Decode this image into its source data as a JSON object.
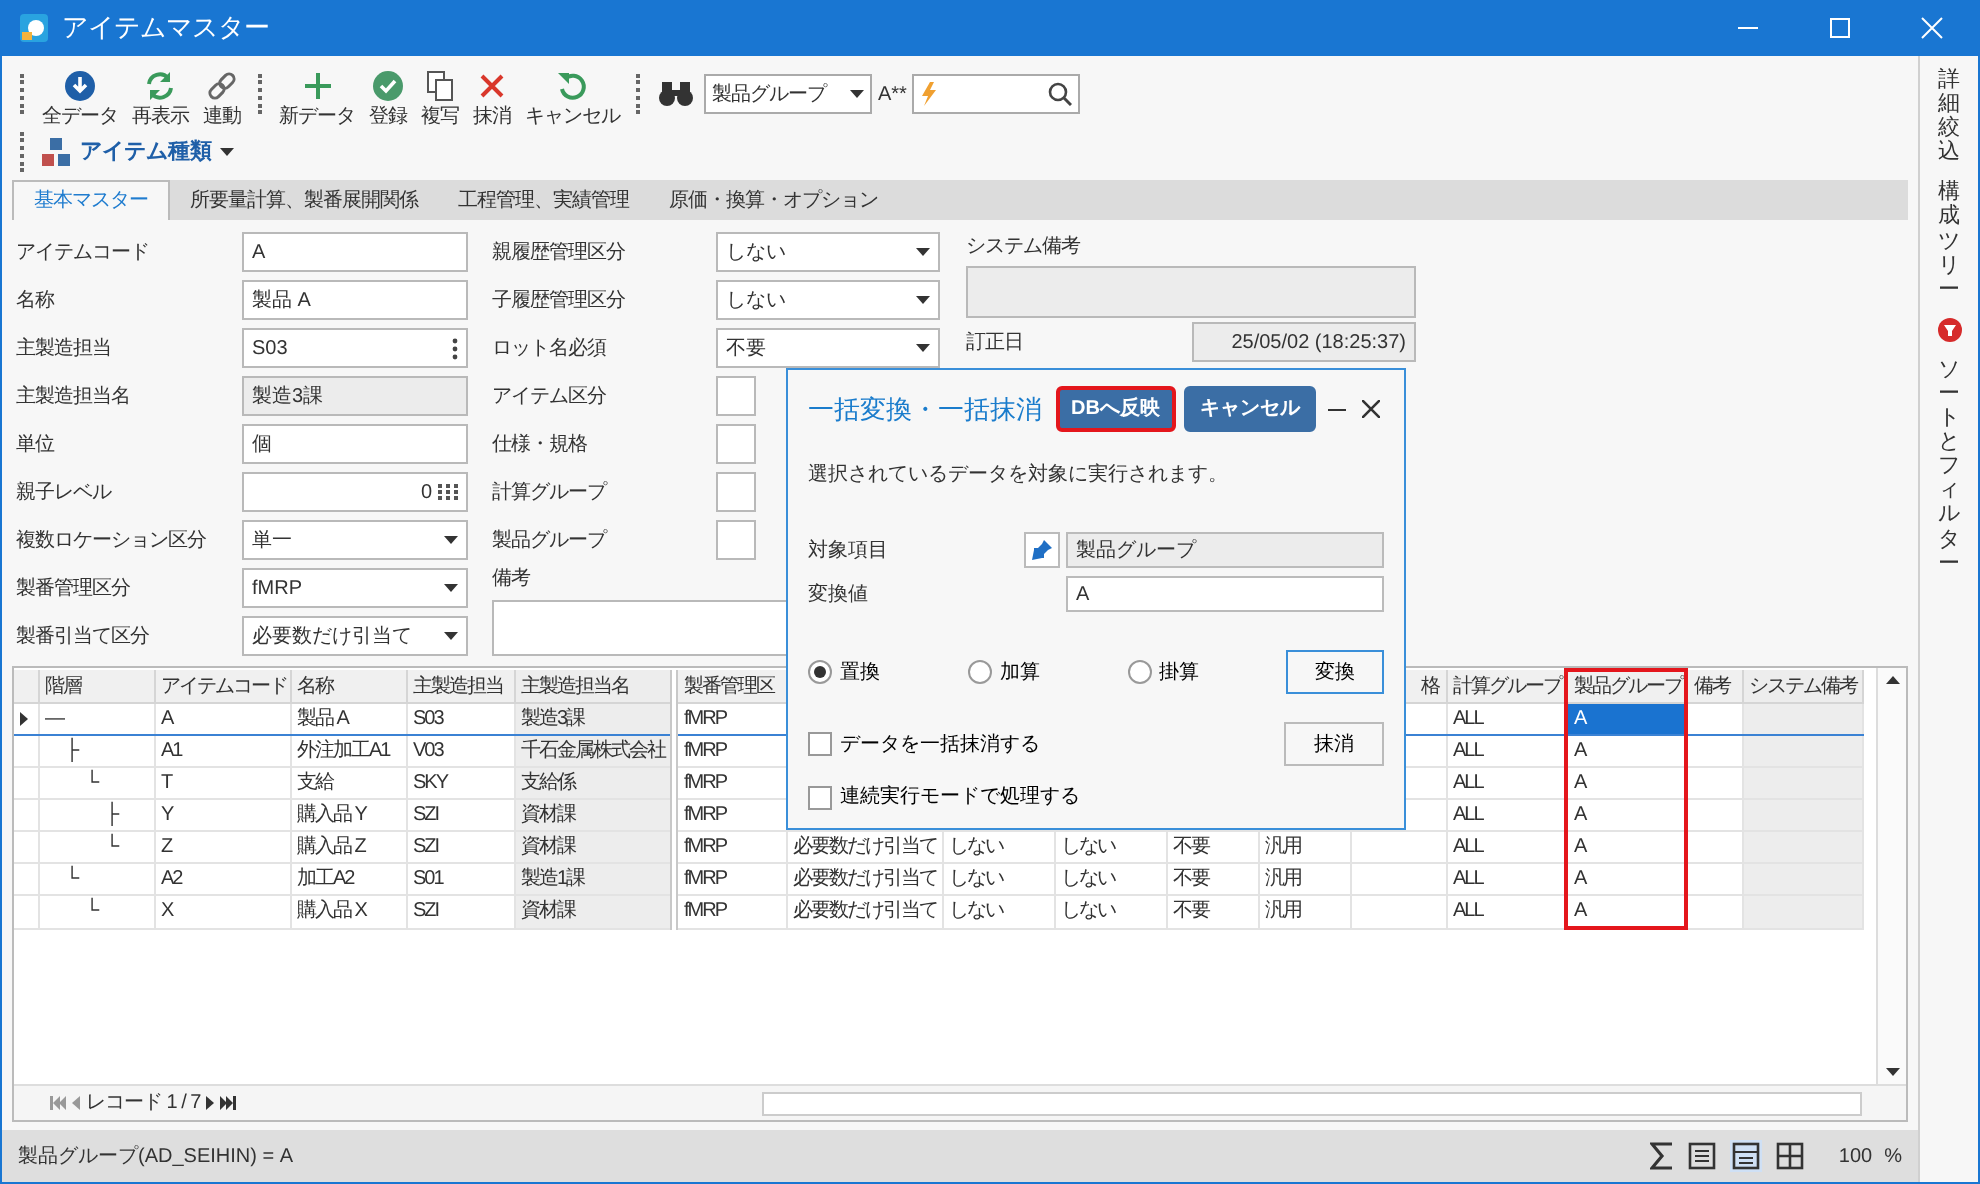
{
  "window": {
    "title": "アイテムマスター"
  },
  "toolbar": {
    "buttons": [
      {
        "label": "全データ"
      },
      {
        "label": "再表示"
      },
      {
        "label": "連動"
      },
      {
        "label": "新データ"
      },
      {
        "label": "登録"
      },
      {
        "label": "複写"
      },
      {
        "label": "抹消"
      },
      {
        "label": "キャンセル"
      }
    ],
    "field_select": {
      "value": "製品グループ"
    },
    "case_label": "A**",
    "item_type_menu": {
      "label": "アイテム種類"
    }
  },
  "tabs": [
    {
      "label": "基本マスター",
      "selected": true
    },
    {
      "label": "所要量計算、製番展開関係",
      "selected": false
    },
    {
      "label": "工程管理、実績管理",
      "selected": false
    },
    {
      "label": "原価・換算・オプション",
      "selected": false
    }
  ],
  "form": {
    "left": [
      {
        "label": "アイテムコード",
        "value": "A",
        "kind": "text"
      },
      {
        "label": "名称",
        "value": "製品 A",
        "kind": "text"
      },
      {
        "label": "主製造担当",
        "value": "S03",
        "kind": "lookup"
      },
      {
        "label": "主製造担当名",
        "value": "製造3課",
        "kind": "readonly"
      },
      {
        "label": "単位",
        "value": "個",
        "kind": "text"
      },
      {
        "label": "親子レベル",
        "value": "0",
        "kind": "number"
      },
      {
        "label": "複数ロケーション区分",
        "value": "単一",
        "kind": "select"
      },
      {
        "label": "製番管理区分",
        "value": "fMRP",
        "kind": "select"
      },
      {
        "label": "製番引当て区分",
        "value": "必要数だけ引当て",
        "kind": "select"
      }
    ],
    "middle": [
      {
        "label": "親履歴管理区分",
        "value": "しない",
        "kind": "select"
      },
      {
        "label": "子履歴管理区分",
        "value": "しない",
        "kind": "select"
      },
      {
        "label": "ロット名必須",
        "value": "不要",
        "kind": "select"
      },
      {
        "label": "アイテム区分",
        "kind": "select"
      },
      {
        "label": "仕様・規格",
        "kind": "select"
      },
      {
        "label": "計算グループ",
        "kind": "select"
      },
      {
        "label": "製品グループ",
        "kind": "select"
      },
      {
        "label": "備考",
        "kind": "textarea"
      }
    ],
    "system_note": {
      "label": "システム備考"
    },
    "corrected": {
      "label": "訂正日",
      "value": "25/05/02 (18:25:37)"
    }
  },
  "dialog": {
    "title": "一括変換・一括抹消",
    "buttons": [
      {
        "label": "DBへ反映",
        "highlighted": true
      },
      {
        "label": "キャンセル",
        "highlighted": false
      }
    ],
    "message": "選択されているデータを対象に実行されます。",
    "target": {
      "label": "対象項目",
      "value": "製品グループ"
    },
    "new_value": {
      "label": "変換値",
      "value": "A"
    },
    "operations": [
      {
        "label": "置換",
        "selected": true
      },
      {
        "label": "加算",
        "selected": false
      },
      {
        "label": "掛算",
        "selected": false
      }
    ],
    "convert_button": "変換",
    "delete_all": {
      "label": "データを一括抹消する",
      "checked": false
    },
    "delete_button": "抹消",
    "continuous": {
      "label": "連続実行モードで処理する",
      "checked": false
    }
  },
  "grid": {
    "columns": [
      {
        "label": "階層"
      },
      {
        "label": "アイテムコード"
      },
      {
        "label": "名称"
      },
      {
        "label": "主製造担当"
      },
      {
        "label": "主製造担当名",
        "shaded": true
      },
      {
        "label": "製番管理区"
      },
      {},
      {},
      {},
      {},
      {},
      {
        "label": "格"
      },
      {
        "label": "計算グループ"
      },
      {
        "label": "製品グループ",
        "highlighted": true,
        "current": true
      },
      {
        "label": "備考"
      },
      {
        "label": "システム備考",
        "shaded": true
      }
    ],
    "rows": [
      {
        "selected": true,
        "cells": [
          "—",
          "A",
          "製品 A",
          "S03",
          "製造3課",
          "fMRP",
          null,
          null,
          null,
          null,
          null,
          null,
          "ALL",
          "A",
          null,
          null
        ],
        "children": [
          {
            "selected": false,
            "cells": [
              "├",
              "A1",
              "外注加工A1",
              "V03",
              "千石金属株式会社",
              "fMRP",
              null,
              null,
              null,
              null,
              null,
              null,
              "ALL",
              "A",
              null,
              null
            ],
            "children": [
              {
                "selected": false,
                "cells": [
                  "└",
                  "T",
                  "支給",
                  "SKY",
                  "支給係",
                  "fMRP",
                  null,
                  null,
                  null,
                  null,
                  null,
                  null,
                  "ALL",
                  "A",
                  null,
                  null
                ],
                "children": [
                  {
                    "selected": false,
                    "cells": [
                      "├",
                      "Y",
                      "購入品 Y",
                      "SZI",
                      "資材課",
                      "fMRP",
                      null,
                      null,
                      null,
                      null,
                      null,
                      null,
                      "ALL",
                      "A",
                      null,
                      null
                    ]
                  },
                  {
                    "selected": false,
                    "cells": [
                      "└",
                      "Z",
                      "購入品 Z",
                      "SZI",
                      "資材課",
                      "fMRP",
                      "必要数だけ引当て",
                      "しない",
                      "しない",
                      "不要",
                      "汎用",
                      null,
                      "ALL",
                      "A",
                      null,
                      null
                    ]
                  }
                ]
              }
            ]
          },
          {
            "selected": false,
            "cells": [
              "└",
              "A2",
              "加工A2",
              "S01",
              "製造1課",
              "fMRP",
              "必要数だけ引当て",
              "しない",
              "しない",
              "不要",
              "汎用",
              null,
              "ALL",
              "A",
              null,
              null
            ],
            "children": [
              {
                "selected": false,
                "cells": [
                  "└",
                  "X",
                  "購入品 X",
                  "SZI",
                  "資材課",
                  "fMRP",
                  "必要数だけ引当て",
                  "しない",
                  "しない",
                  "不要",
                  "汎用",
                  null,
                  "ALL",
                  "A",
                  null,
                  null
                ]
              }
            ]
          }
        ]
      }
    ],
    "pager": {
      "text": "レコード 1 / 7"
    }
  },
  "status_bar": {
    "text": "製品グループ(AD_SEIHIN) = A",
    "views": [
      {
        "selected": false
      },
      {
        "selected": true
      },
      {
        "selected": false
      }
    ],
    "zoom": "100",
    "zoom_unit": "%"
  },
  "side_panel": [
    {
      "label": "詳細絞込",
      "filter_active": false
    },
    {
      "label": "構成ツリー",
      "filter_active": false
    },
    {
      "label": "ソートとフィルター",
      "filter_active": true
    }
  ]
}
